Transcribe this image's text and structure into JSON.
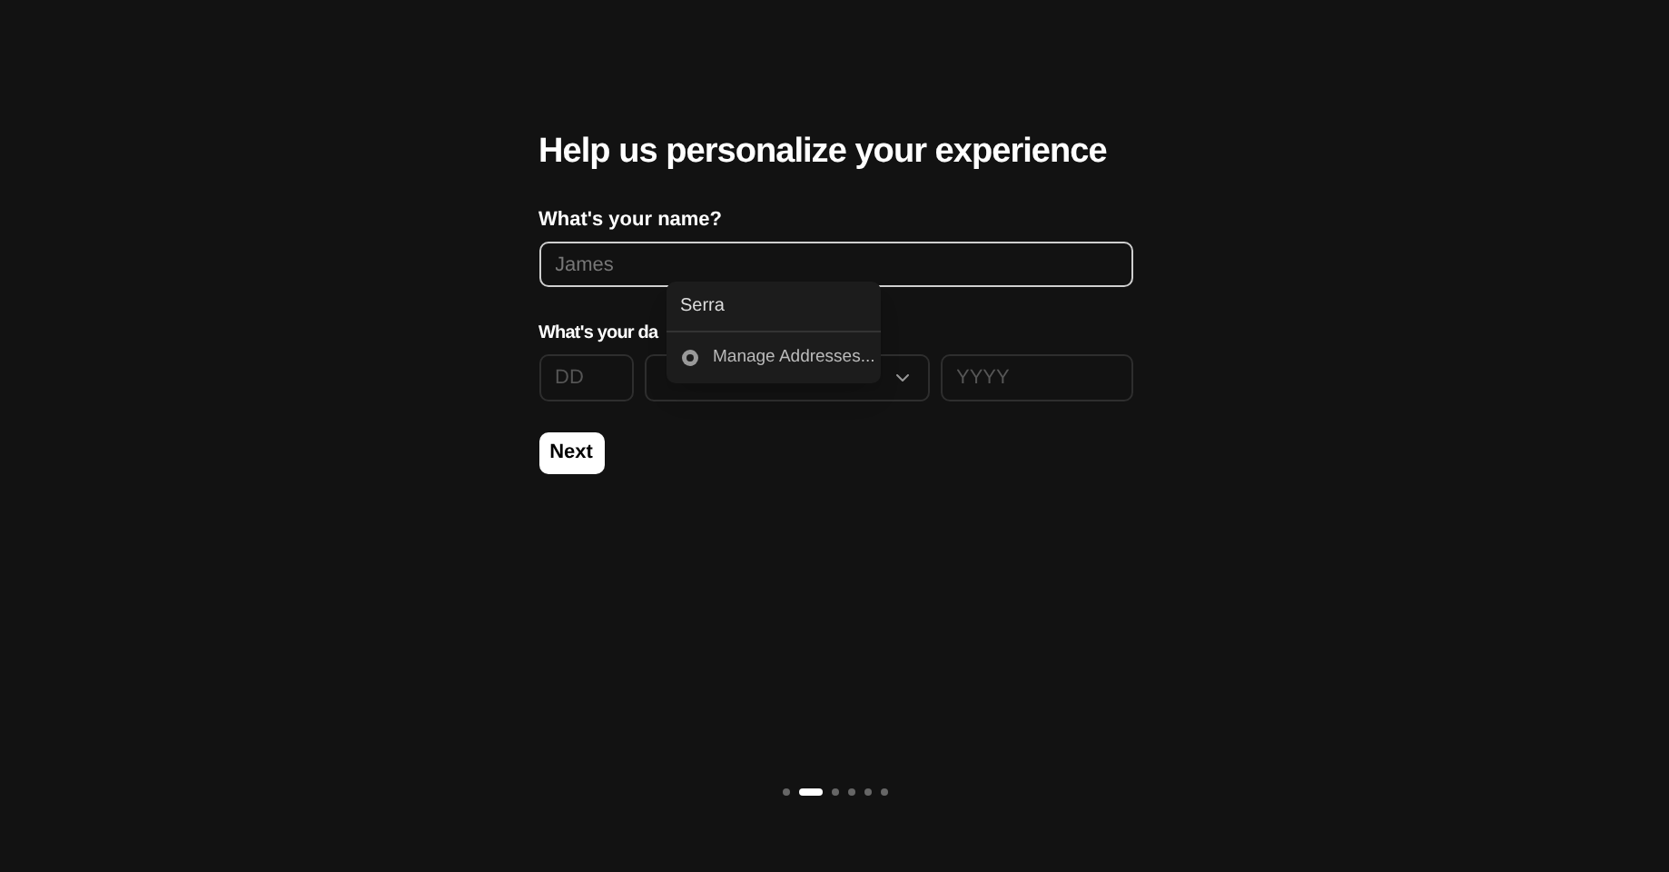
{
  "title": "Help us personalize your experience",
  "name_field": {
    "label": "What's your name?",
    "placeholder": "James"
  },
  "date_field": {
    "label": "What's your da",
    "day_placeholder": "DD",
    "year_placeholder": "YYYY"
  },
  "autofill": {
    "suggestion": "Serra",
    "manage": "Manage Addresses..."
  },
  "next_button": "Next",
  "steps": [
    {
      "selected": false
    },
    {
      "selected": true
    },
    {
      "selected": false
    },
    {
      "selected": false
    },
    {
      "selected": false
    },
    {
      "selected": false
    }
  ]
}
